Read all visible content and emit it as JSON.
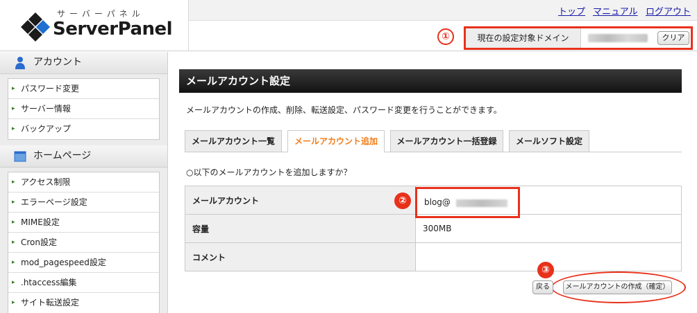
{
  "header": {
    "logo_kana": "サーバーパネル",
    "logo_text": "ServerPanel",
    "nav": [
      "トップ",
      "マニュアル",
      "ログアウト"
    ],
    "domain_label": "現在の設定対象ドメイン",
    "clear_label": "クリア"
  },
  "markers": [
    "①",
    "②",
    "③"
  ],
  "sidebar": {
    "sections": [
      {
        "title": "アカウント",
        "icon": "user-icon",
        "items": [
          "パスワード変更",
          "サーバー情報",
          "バックアップ"
        ]
      },
      {
        "title": "ホームページ",
        "icon": "window-icon",
        "items": [
          "アクセス制限",
          "エラーページ設定",
          "MIME設定",
          "Cron設定",
          "mod_pagespeed設定",
          ".htaccess編集",
          "サイト転送設定"
        ]
      }
    ]
  },
  "main": {
    "title": "メールアカウント設定",
    "description": "メールアカウントの作成、削除、転送設定、パスワード変更を行うことができます。",
    "tabs": [
      {
        "label": "メールアカウント一覧",
        "active": false
      },
      {
        "label": "メールアカウント追加",
        "active": true
      },
      {
        "label": "メールアカウント一括登録",
        "active": false
      },
      {
        "label": "メールソフト設定",
        "active": false
      }
    ],
    "question": "○以下のメールアカウントを追加しますか？",
    "rows": [
      {
        "label": "メールアカウント",
        "value": "blog@"
      },
      {
        "label": "容量",
        "value": "300MB"
      },
      {
        "label": "コメント",
        "value": ""
      }
    ],
    "back_label": "戻る",
    "create_label": "メールアカウントの作成（確定）"
  },
  "colors": {
    "accent": "#e8311b",
    "active_tab": "#f07d1a",
    "link": "#1a1aa8"
  }
}
